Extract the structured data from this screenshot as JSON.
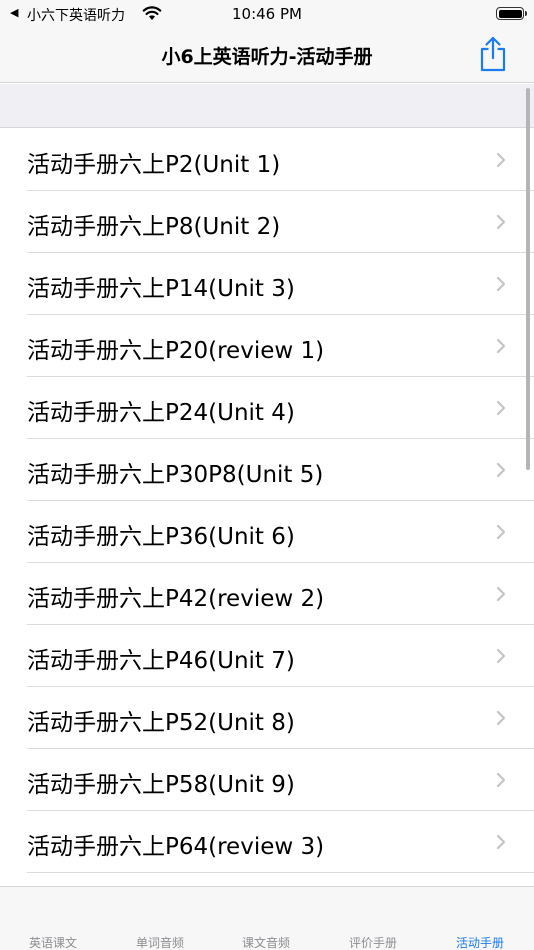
{
  "status_bar": {
    "back_glyph": "◀",
    "app_name": "小六下英语听力",
    "time": "10:46 PM"
  },
  "nav": {
    "title": "小6上英语听力-活动手册"
  },
  "list": {
    "items": [
      {
        "label": "活动手册六上P2(Unit 1)"
      },
      {
        "label": "活动手册六上P8(Unit 2)"
      },
      {
        "label": "活动手册六上P14(Unit 3)"
      },
      {
        "label": "活动手册六上P20(review 1)"
      },
      {
        "label": "活动手册六上P24(Unit 4)"
      },
      {
        "label": "活动手册六上P30P8(Unit 5)"
      },
      {
        "label": "活动手册六上P36(Unit 6)"
      },
      {
        "label": "活动手册六上P42(review 2)"
      },
      {
        "label": "活动手册六上P46(Unit 7)"
      },
      {
        "label": "活动手册六上P52(Unit 8)"
      },
      {
        "label": "活动手册六上P58(Unit 9)"
      },
      {
        "label": "活动手册六上P64(review 3)"
      }
    ]
  },
  "tab_bar": {
    "tabs": [
      {
        "label": "英语课文",
        "active": false
      },
      {
        "label": "单词音频",
        "active": false
      },
      {
        "label": "课文音频",
        "active": false
      },
      {
        "label": "评价手册",
        "active": false
      },
      {
        "label": "活动手册",
        "active": true
      }
    ]
  },
  "colors": {
    "accent": "#1b7cf0",
    "inactive_tab": "#8e8e93",
    "bar_background": "#f7f7f7",
    "section_background": "#efeff4",
    "chevron": "#c4c4c7"
  },
  "icons": {
    "status_wifi": "wifi-icon",
    "status_battery": "battery-icon",
    "share": "share-icon",
    "chevron": "chevron-right-icon"
  }
}
